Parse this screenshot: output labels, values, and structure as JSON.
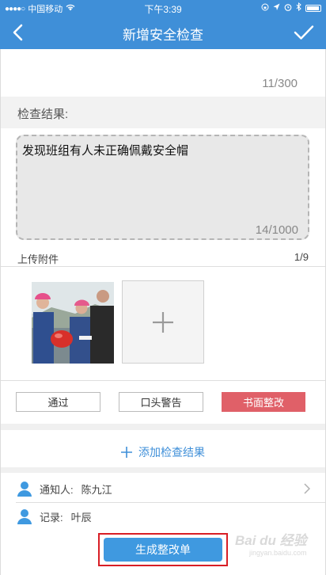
{
  "status_bar": {
    "carrier": "中国移动",
    "time": "下午3:39"
  },
  "nav": {
    "title": "新增安全检查",
    "back_icon": "chevron-left-icon",
    "confirm_icon": "checkmark-icon"
  },
  "description": {
    "counter": "11/300"
  },
  "check_result": {
    "label": "检查结果:",
    "text": "发现班组有人未正确佩戴安全帽",
    "counter": "14/1000"
  },
  "attachments": {
    "label": "上传附件",
    "count": "1/9",
    "add_icon": "plus-icon"
  },
  "status_buttons": {
    "pass": "通过",
    "verbal_warning": "口头警告",
    "written_rectification": "书面整改",
    "selected_color": "#e06068"
  },
  "add_result": {
    "label": "添加检查结果"
  },
  "notify": {
    "label": "通知人:",
    "name": "陈九江"
  },
  "record": {
    "label": "记录:",
    "name": "叶辰"
  },
  "generate": {
    "label": "生成整改单"
  },
  "watermark": {
    "brand": "Bai du 经验",
    "url": "jingyan.baidu.com"
  },
  "colors": {
    "primary": "#3f8fd8",
    "highlight_border": "#d81e25"
  }
}
